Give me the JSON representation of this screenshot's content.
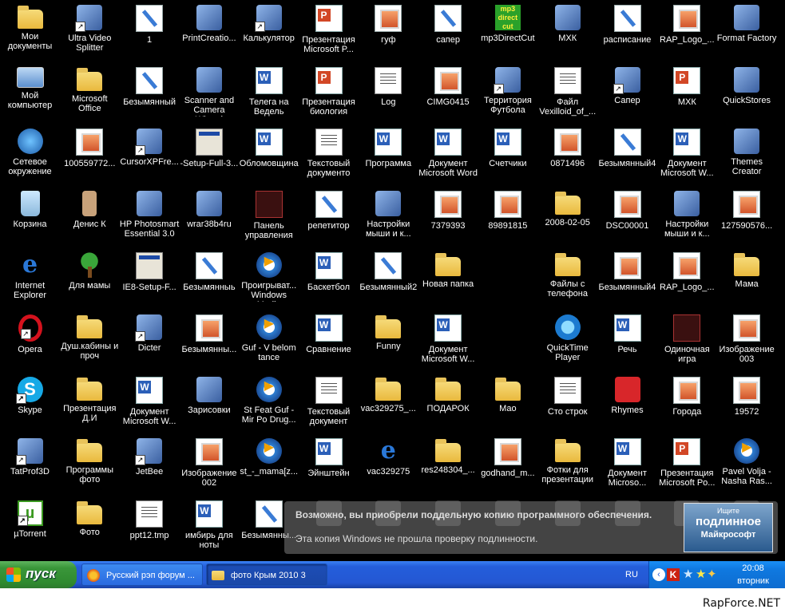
{
  "desktop": {
    "columns": [
      [
        {
          "label": "Мои документы",
          "icon": "folder-icon",
          "kind": "folder"
        },
        {
          "label": "Мой компьютер",
          "icon": "computer-icon",
          "kind": "pc"
        },
        {
          "label": "Сетевое окружение",
          "icon": "network-icon",
          "kind": "net"
        },
        {
          "label": "Корзина",
          "icon": "recycle-bin-icon",
          "kind": "bin"
        },
        {
          "label": "Internet Explorer",
          "icon": "internet-explorer-icon",
          "kind": "ie"
        },
        {
          "label": "Opera",
          "icon": "opera-icon",
          "kind": "opera",
          "shortcut": true
        },
        {
          "label": "Skype",
          "icon": "skype-icon",
          "kind": "skype",
          "shortcut": true
        },
        {
          "label": "TatProf3D",
          "icon": "tatprof-icon",
          "kind": "app",
          "shortcut": true
        },
        {
          "label": "µTorrent",
          "icon": "utorrent-icon",
          "kind": "utorrent",
          "shortcut": true
        }
      ],
      [
        {
          "label": "Ultra Video Splitter",
          "icon": "video-splitter-icon",
          "kind": "app",
          "shortcut": true
        },
        {
          "label": "Microsoft Office",
          "icon": "folder-icon",
          "kind": "folder"
        },
        {
          "label": "100559772...",
          "icon": "image-file-icon",
          "kind": "image"
        },
        {
          "label": "Денис К",
          "icon": "phone-icon",
          "kind": "phone"
        },
        {
          "label": "Для мамы",
          "icon": "tree-icon",
          "kind": "tree"
        },
        {
          "label": "Душ.кабины и проч",
          "icon": "folder-icon",
          "kind": "folder"
        },
        {
          "label": "Презентация Д.И",
          "icon": "folder-icon",
          "kind": "folder"
        },
        {
          "label": "Программы фото",
          "icon": "folder-icon",
          "kind": "folder"
        },
        {
          "label": "Фото",
          "icon": "folder-icon",
          "kind": "folder"
        }
      ],
      [
        {
          "label": "1",
          "icon": "paint-file-icon",
          "kind": "paint"
        },
        {
          "label": "Безымянный",
          "icon": "paint-file-icon",
          "kind": "paint"
        },
        {
          "label": "CursorXPFre...",
          "icon": "cursorxp-icon",
          "kind": "app",
          "shortcut": true
        },
        {
          "label": "HP Photosmart Essential 3.0",
          "icon": "hp-photosmart-icon",
          "kind": "app"
        },
        {
          "label": "IE8-Setup-F...",
          "icon": "installer-icon",
          "kind": "exe"
        },
        {
          "label": "Dicter",
          "icon": "dicter-icon",
          "kind": "app",
          "shortcut": true
        },
        {
          "label": "Документ Microsoft W...",
          "icon": "word-doc-icon",
          "kind": "word"
        },
        {
          "label": "JetBee",
          "icon": "jetbee-icon",
          "kind": "app",
          "shortcut": true
        },
        {
          "label": "ppt12.tmp",
          "icon": "tmp-file-icon",
          "kind": "text"
        }
      ],
      [
        {
          "label": "PrintCreatio...",
          "icon": "print-creations-icon",
          "kind": "app"
        },
        {
          "label": "Scanner and Camera Wizard",
          "icon": "scanner-icon",
          "kind": "app"
        },
        {
          "label": "-Setup-Full-3...",
          "icon": "installer-icon",
          "kind": "exe"
        },
        {
          "label": "wrar38b4ru",
          "icon": "winrar-icon",
          "kind": "app"
        },
        {
          "label": "Безымянныь",
          "icon": "paint-file-icon",
          "kind": "paint"
        },
        {
          "label": "Безымянны...",
          "icon": "image-file-icon",
          "kind": "image"
        },
        {
          "label": "Зарисовки",
          "icon": "sketch-icon",
          "kind": "app"
        },
        {
          "label": "Изображение 002",
          "icon": "image-file-icon",
          "kind": "image"
        },
        {
          "label": "имбирь для ноты",
          "icon": "word-doc-icon",
          "kind": "word"
        }
      ],
      [
        {
          "label": "Калькулятор",
          "icon": "calculator-icon",
          "kind": "app",
          "shortcut": true
        },
        {
          "label": "Телега на Ведель",
          "icon": "word-doc-icon",
          "kind": "word"
        },
        {
          "label": "Обломовщина",
          "icon": "word-doc-icon",
          "kind": "word"
        },
        {
          "label": "Панель управления",
          "icon": "control-panel-icon",
          "kind": "game"
        },
        {
          "label": "Проигрыват... Windows Media",
          "icon": "media-player-icon",
          "kind": "media"
        },
        {
          "label": "Guf - V belom tance",
          "icon": "media-file-icon",
          "kind": "media"
        },
        {
          "label": "St Feat Guf - Mir Po Drug...",
          "icon": "media-file-icon",
          "kind": "media"
        },
        {
          "label": "st_-_mama[z...",
          "icon": "media-file-icon",
          "kind": "media"
        },
        {
          "label": "Безымянны...",
          "icon": "paint-file-icon",
          "kind": "paint"
        }
      ],
      [
        {
          "label": "Презентация Microsoft P...",
          "icon": "powerpoint-icon",
          "kind": "ppt"
        },
        {
          "label": "Презентация биология",
          "icon": "powerpoint-icon",
          "kind": "ppt"
        },
        {
          "label": "Текстовый документо",
          "icon": "text-doc-icon",
          "kind": "text"
        },
        {
          "label": "репетитор",
          "icon": "paint-file-icon",
          "kind": "paint"
        },
        {
          "label": "Баскетбол",
          "icon": "word-doc-icon",
          "kind": "word"
        },
        {
          "label": "Сравнение",
          "icon": "word-doc-icon",
          "kind": "word"
        },
        {
          "label": "Текстовый документ",
          "icon": "text-doc-icon",
          "kind": "text"
        },
        {
          "label": "Эйнштейн",
          "icon": "word-doc-icon",
          "kind": "word"
        },
        {
          "label": "",
          "icon": "hidden-icon",
          "kind": "stub"
        }
      ],
      [
        {
          "label": "гуф",
          "icon": "image-file-icon",
          "kind": "image"
        },
        {
          "label": "Log",
          "icon": "text-doc-icon",
          "kind": "text"
        },
        {
          "label": "Программа",
          "icon": "word-doc-icon",
          "kind": "word"
        },
        {
          "label": "Настройки мыши и к...",
          "icon": "mouse-settings-icon",
          "kind": "app"
        },
        {
          "label": "Безымянный2",
          "icon": "paint-file-icon",
          "kind": "paint"
        },
        {
          "label": "Funny",
          "icon": "folder-icon",
          "kind": "folder"
        },
        {
          "label": "vac329275_...",
          "icon": "folder-icon",
          "kind": "folder"
        },
        {
          "label": "vac329275",
          "icon": "internet-explorer-icon",
          "kind": "ie"
        },
        {
          "label": "",
          "icon": "hidden-icon",
          "kind": "stub"
        }
      ],
      [
        {
          "label": "сапер",
          "icon": "paint-file-icon",
          "kind": "paint"
        },
        {
          "label": "CIMG0415",
          "icon": "image-file-icon",
          "kind": "image"
        },
        {
          "label": "Документ Microsoft Word",
          "icon": "word-doc-icon",
          "kind": "word"
        },
        {
          "label": "7379393",
          "icon": "image-file-icon",
          "kind": "image"
        },
        {
          "label": "Новая папка",
          "icon": "folder-icon",
          "kind": "folder"
        },
        {
          "label": "Документ Microsoft W...",
          "icon": "word-doc-icon",
          "kind": "word"
        },
        {
          "label": "ПОДАРОК",
          "icon": "folder-icon",
          "kind": "folder"
        },
        {
          "label": "res248304_...",
          "icon": "folder-icon",
          "kind": "folder"
        },
        {
          "label": "",
          "icon": "hidden-icon",
          "kind": "stub"
        }
      ],
      [
        {
          "label": "mp3DirectCut",
          "icon": "mp3directcut-icon",
          "kind": "mp3"
        },
        {
          "label": "Территория Футбола",
          "icon": "football-icon",
          "kind": "app",
          "shortcut": true
        },
        {
          "label": "Счетчики",
          "icon": "word-doc-icon",
          "kind": "word"
        },
        {
          "label": "89891815",
          "icon": "image-file-icon",
          "kind": "image"
        },
        {
          "label": "",
          "icon": "empty-slot",
          "kind": "none"
        },
        {
          "label": "",
          "icon": "empty-slot",
          "kind": "none"
        },
        {
          "label": "Мао",
          "icon": "folder-icon",
          "kind": "folder"
        },
        {
          "label": "godhand_m...",
          "icon": "image-file-icon",
          "kind": "image"
        },
        {
          "label": "",
          "icon": "hidden-icon",
          "kind": "stub"
        }
      ],
      [
        {
          "label": "МХК",
          "icon": "hands-icon",
          "kind": "app"
        },
        {
          "label": "Файл Vexilloid_of_...",
          "icon": "vexilloid-file-icon",
          "kind": "text"
        },
        {
          "label": "0871496",
          "icon": "image-file-icon",
          "kind": "image"
        },
        {
          "label": "2008-02-05",
          "icon": "folder-icon",
          "kind": "folder"
        },
        {
          "label": "Файлы с телефона",
          "icon": "folder-icon",
          "kind": "folder"
        },
        {
          "label": "QuickTime Player",
          "icon": "quicktime-icon",
          "kind": "quick"
        },
        {
          "label": "Сто строк",
          "icon": "text-doc-icon",
          "kind": "text"
        },
        {
          "label": "Фотки для презентации",
          "icon": "folder-icon",
          "kind": "folder"
        },
        {
          "label": "",
          "icon": "hidden-icon",
          "kind": "stub"
        }
      ],
      [
        {
          "label": "расписание",
          "icon": "paint-file-icon",
          "kind": "paint"
        },
        {
          "label": "Сапер",
          "icon": "minesweeper-icon",
          "kind": "app",
          "shortcut": true
        },
        {
          "label": "Безымянный4",
          "icon": "paint-file-icon",
          "kind": "paint"
        },
        {
          "label": "DSC00001",
          "icon": "image-file-icon",
          "kind": "image"
        },
        {
          "label": "Безымянный4",
          "icon": "image-file-icon",
          "kind": "image"
        },
        {
          "label": "Речь",
          "icon": "word-doc-icon",
          "kind": "word"
        },
        {
          "label": "Rhymes",
          "icon": "rhymes-icon",
          "kind": "red"
        },
        {
          "label": "Документ Microso...",
          "icon": "word-doc-icon",
          "kind": "word"
        },
        {
          "label": "",
          "icon": "hidden-icon",
          "kind": "stub"
        }
      ],
      [
        {
          "label": "RAP_Logo_...",
          "icon": "image-file-icon",
          "kind": "image"
        },
        {
          "label": "МХК",
          "icon": "powerpoint-icon",
          "kind": "ppt"
        },
        {
          "label": "Документ Microsoft W...",
          "icon": "word-doc-icon",
          "kind": "word"
        },
        {
          "label": "Настройки мыши и к...",
          "icon": "mouse-settings-icon",
          "kind": "app"
        },
        {
          "label": "RAP_Logo_...",
          "icon": "image-file-icon",
          "kind": "image"
        },
        {
          "label": "Одиночная игра",
          "icon": "game-icon",
          "kind": "game"
        },
        {
          "label": "Города",
          "icon": "image-file-icon",
          "kind": "image"
        },
        {
          "label": "Презентация Microsoft Po...",
          "icon": "powerpoint-icon",
          "kind": "ppt"
        },
        {
          "label": "",
          "icon": "hidden-icon",
          "kind": "stub"
        }
      ],
      [
        {
          "label": "Format Factory",
          "icon": "format-factory-icon",
          "kind": "app"
        },
        {
          "label": "QuickStores",
          "icon": "quickstores-icon",
          "kind": "app"
        },
        {
          "label": "Themes Creator",
          "icon": "themes-creator-icon",
          "kind": "app"
        },
        {
          "label": "127590576...",
          "icon": "image-file-icon",
          "kind": "image"
        },
        {
          "label": "Мама",
          "icon": "folder-icon",
          "kind": "folder"
        },
        {
          "label": "Изображение 003",
          "icon": "image-file-icon",
          "kind": "image"
        },
        {
          "label": "19572",
          "icon": "image-file-icon",
          "kind": "image"
        },
        {
          "label": "Pavel Volja - Nasha Ras...",
          "icon": "media-file-icon",
          "kind": "media"
        },
        {
          "label": "",
          "icon": "hidden-icon",
          "kind": "stub"
        }
      ]
    ]
  },
  "wga_notice": {
    "line1": "Возможно, вы приобрели поддельную копию программного обеспечения.",
    "line2": "Эта копия Windows не прошла проверку подлинности.",
    "badge_top": "Ищите",
    "badge_mid": "подлинное",
    "badge_bottom": "Майкрософт"
  },
  "taskbar": {
    "start_label": "пуск",
    "tasks": [
      {
        "label": "Русский рэп форум ...",
        "icon": "firefox-icon",
        "active": false
      },
      {
        "label": "фото Крым 2010 3",
        "icon": "folder-icon",
        "active": true
      }
    ],
    "language": "RU",
    "tray": {
      "time": "20:08",
      "day": "вторник"
    }
  },
  "watermark": "RapForce.NET"
}
